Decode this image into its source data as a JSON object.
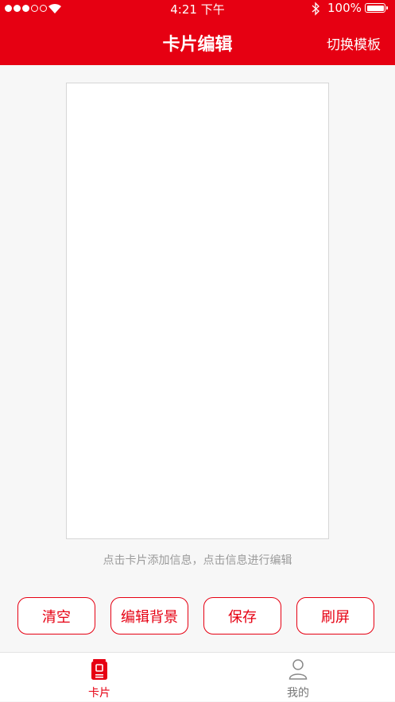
{
  "status_bar": {
    "time": "4:21 下午",
    "battery": "100%"
  },
  "nav": {
    "title": "卡片编辑",
    "right_action": "切换模板"
  },
  "hint": "点击卡片添加信息，点击信息进行编辑",
  "actions": {
    "clear": "清空",
    "edit_background": "编辑背景",
    "save": "保存",
    "refresh": "刷屏"
  },
  "tabs": [
    {
      "label": "卡片",
      "icon": "card-icon",
      "active": true
    },
    {
      "label": "我的",
      "icon": "person-icon",
      "active": false
    }
  ],
  "colors": {
    "brand": "#e60012",
    "background": "#f7f7f7",
    "hint": "#9a9a9a"
  }
}
